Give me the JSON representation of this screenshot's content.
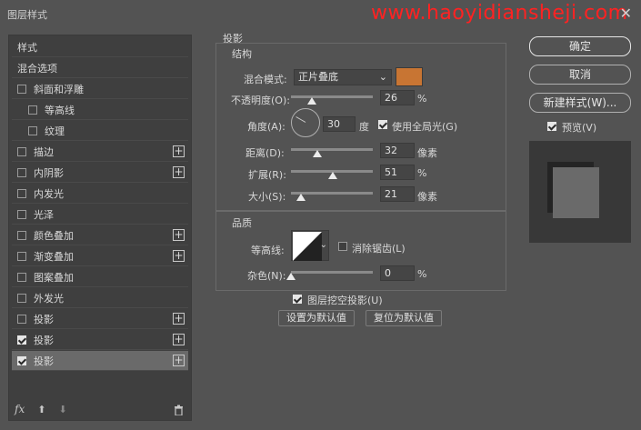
{
  "window": {
    "title": "图层样式",
    "watermark": "www.haoyidiansheji.com",
    "close": "✕"
  },
  "left_panel": {
    "header": "样式",
    "items": [
      {
        "label": "混合选项",
        "checkbox": false,
        "has_checkbox": false,
        "plus": false,
        "indent": false,
        "selected": false
      },
      {
        "label": "斜面和浮雕",
        "checkbox": false,
        "has_checkbox": true,
        "plus": false,
        "indent": false,
        "selected": false
      },
      {
        "label": "等高线",
        "checkbox": false,
        "has_checkbox": true,
        "plus": false,
        "indent": true,
        "selected": false
      },
      {
        "label": "纹理",
        "checkbox": false,
        "has_checkbox": true,
        "plus": false,
        "indent": true,
        "selected": false
      },
      {
        "label": "描边",
        "checkbox": false,
        "has_checkbox": true,
        "plus": true,
        "indent": false,
        "selected": false
      },
      {
        "label": "内阴影",
        "checkbox": false,
        "has_checkbox": true,
        "plus": true,
        "indent": false,
        "selected": false
      },
      {
        "label": "内发光",
        "checkbox": false,
        "has_checkbox": true,
        "plus": false,
        "indent": false,
        "selected": false
      },
      {
        "label": "光泽",
        "checkbox": false,
        "has_checkbox": true,
        "plus": false,
        "indent": false,
        "selected": false
      },
      {
        "label": "颜色叠加",
        "checkbox": false,
        "has_checkbox": true,
        "plus": true,
        "indent": false,
        "selected": false
      },
      {
        "label": "渐变叠加",
        "checkbox": false,
        "has_checkbox": true,
        "plus": true,
        "indent": false,
        "selected": false
      },
      {
        "label": "图案叠加",
        "checkbox": false,
        "has_checkbox": true,
        "plus": false,
        "indent": false,
        "selected": false
      },
      {
        "label": "外发光",
        "checkbox": false,
        "has_checkbox": true,
        "plus": false,
        "indent": false,
        "selected": false
      },
      {
        "label": "投影",
        "checkbox": false,
        "has_checkbox": true,
        "plus": true,
        "indent": false,
        "selected": false
      },
      {
        "label": "投影",
        "checkbox": true,
        "has_checkbox": true,
        "plus": true,
        "indent": false,
        "selected": false
      },
      {
        "label": "投影",
        "checkbox": true,
        "has_checkbox": true,
        "plus": true,
        "indent": false,
        "selected": true
      }
    ],
    "footer": {
      "fx": "fx",
      "up": "⬆",
      "down": "⬇",
      "trash": "🗑"
    }
  },
  "shadow": {
    "section_title": "投影",
    "structure": {
      "title": "结构",
      "blend_mode_label": "混合模式:",
      "blend_mode_value": "正片叠底",
      "color": "#c87533",
      "opacity_label": "不透明度(O):",
      "opacity_value": "26",
      "opacity_unit": "%",
      "opacity_fraction": 0.26,
      "angle_label": "角度(A):",
      "angle_value": "30",
      "angle_unit": "度",
      "global_light_label": "使用全局光(G)",
      "global_light_checked": true,
      "distance_label": "距离(D):",
      "distance_value": "32",
      "distance_unit": "像素",
      "distance_fraction": 0.32,
      "spread_label": "扩展(R):",
      "spread_value": "51",
      "spread_unit": "%",
      "spread_fraction": 0.51,
      "size_label": "大小(S):",
      "size_value": "21",
      "size_unit": "像素",
      "size_fraction": 0.12
    },
    "quality": {
      "title": "品质",
      "contour_label": "等高线:",
      "antialias_label": "消除锯齿(L)",
      "antialias_checked": false,
      "noise_label": "杂色(N):",
      "noise_value": "0",
      "noise_unit": "%",
      "noise_fraction": 0.0
    },
    "knockout_label": "图层挖空投影(U)",
    "knockout_checked": true,
    "make_default": "设置为默认值",
    "reset_default": "复位为默认值"
  },
  "buttons": {
    "ok": "确定",
    "cancel": "取消",
    "new_style": "新建样式(W)...",
    "preview_label": "预览(V)",
    "preview_checked": true
  }
}
